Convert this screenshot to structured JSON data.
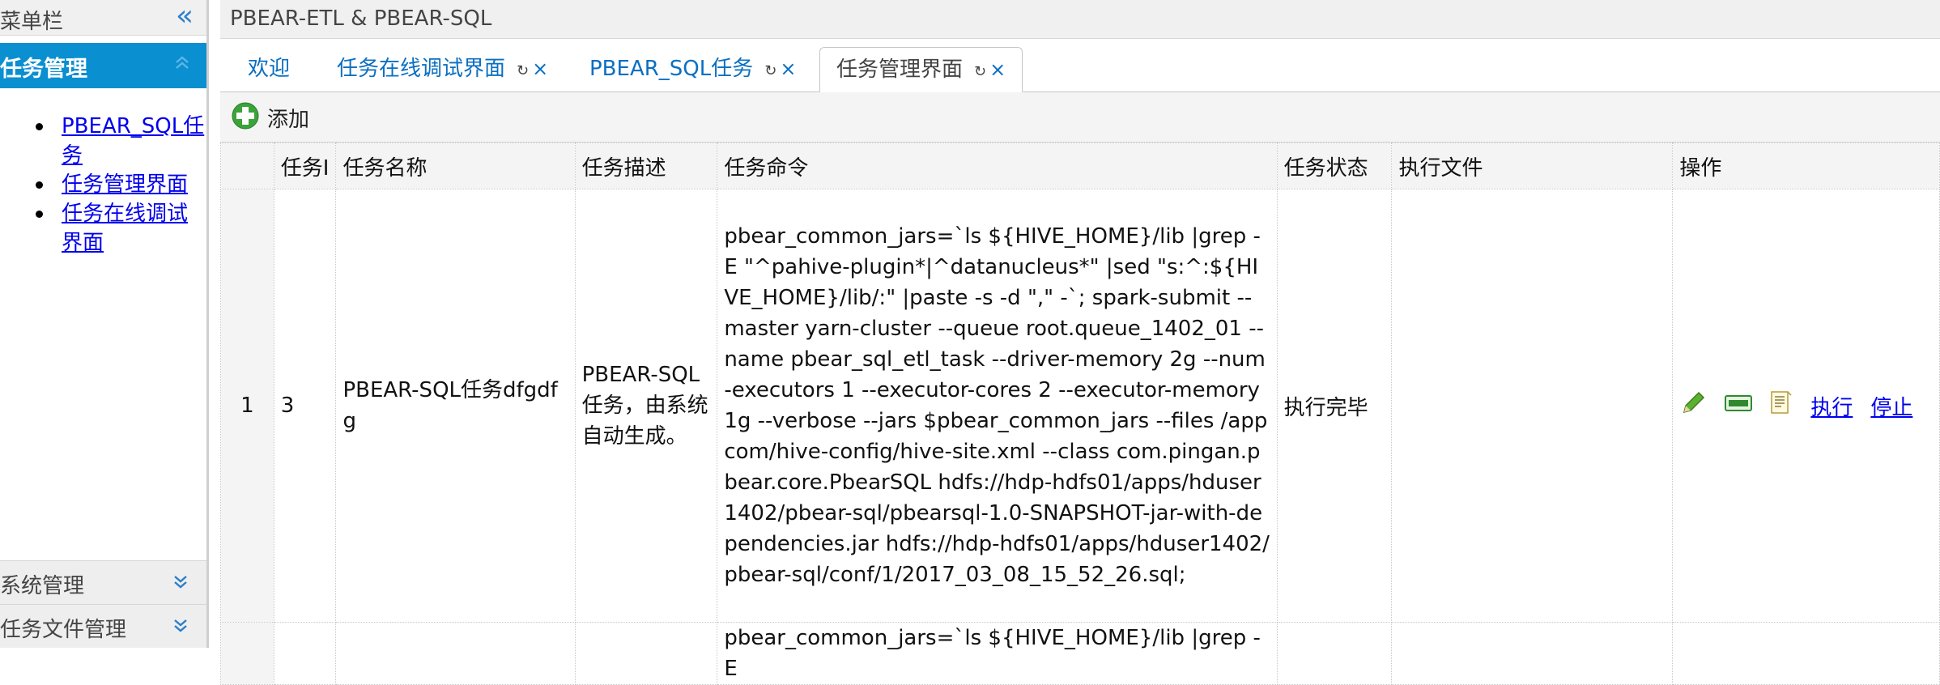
{
  "sidebar": {
    "title": "菜单栏",
    "section": {
      "title": "任务管理",
      "items": [
        "PBEAR_SQL任务",
        "任务管理界面",
        "任务在线调试界面"
      ]
    },
    "bottom_sections": [
      "系统管理",
      "任务文件管理"
    ]
  },
  "app_title": "PBEAR-ETL & PBEAR-SQL",
  "tabs": [
    {
      "label": "欢迎"
    },
    {
      "label": "任务在线调试界面"
    },
    {
      "label": "PBEAR_SQL任务"
    },
    {
      "label": "任务管理界面",
      "active": true
    }
  ],
  "toolbar": {
    "add_label": "添加"
  },
  "table": {
    "columns": [
      "任务I",
      "任务名称",
      "任务描述",
      "任务命令",
      "任务状态",
      "执行文件",
      "操作"
    ],
    "rows": [
      {
        "row_number": "1",
        "id": "3",
        "name": "PBEAR-SQL任务dfgdfg",
        "description": "PBEAR-SQL任务，由系统自动生成。",
        "command": "pbear_common_jars=`ls ${HIVE_HOME}/lib |grep -E \"^pahive-plugin*|^datanucleus*\" |sed \"s:^:${HIVE_HOME}/lib/:\" |paste -s -d \",\" -`; spark-submit --master yarn-cluster --queue root.queue_1402_01 --name pbear_sql_etl_task --driver-memory 2g --num-executors 1 --executor-cores 2 --executor-memory 1g --verbose --jars $pbear_common_jars --files /appcom/hive-config/hive-site.xml --class com.pingan.pbear.core.PbearSQL hdfs://hdp-hdfs01/apps/hduser1402/pbear-sql/pbearsql-1.0-SNAPSHOT-jar-with-dependencies.jar hdfs://hdp-hdfs01/apps/hduser1402/pbear-sql/conf/1/2017_03_08_15_52_26.sql;",
        "status": "执行完毕",
        "exec_file": "",
        "actions": {
          "run": "执行",
          "stop": "停止"
        }
      },
      {
        "row_number": "",
        "id": "",
        "name": "",
        "description": "",
        "command": "pbear_common_jars=`ls ${HIVE_HOME}/lib |grep -E",
        "status": "",
        "exec_file": ""
      }
    ]
  },
  "colors": {
    "accent": "#0a8fd1",
    "link": "#0000ee",
    "tab_text": "#0a6fc2"
  }
}
